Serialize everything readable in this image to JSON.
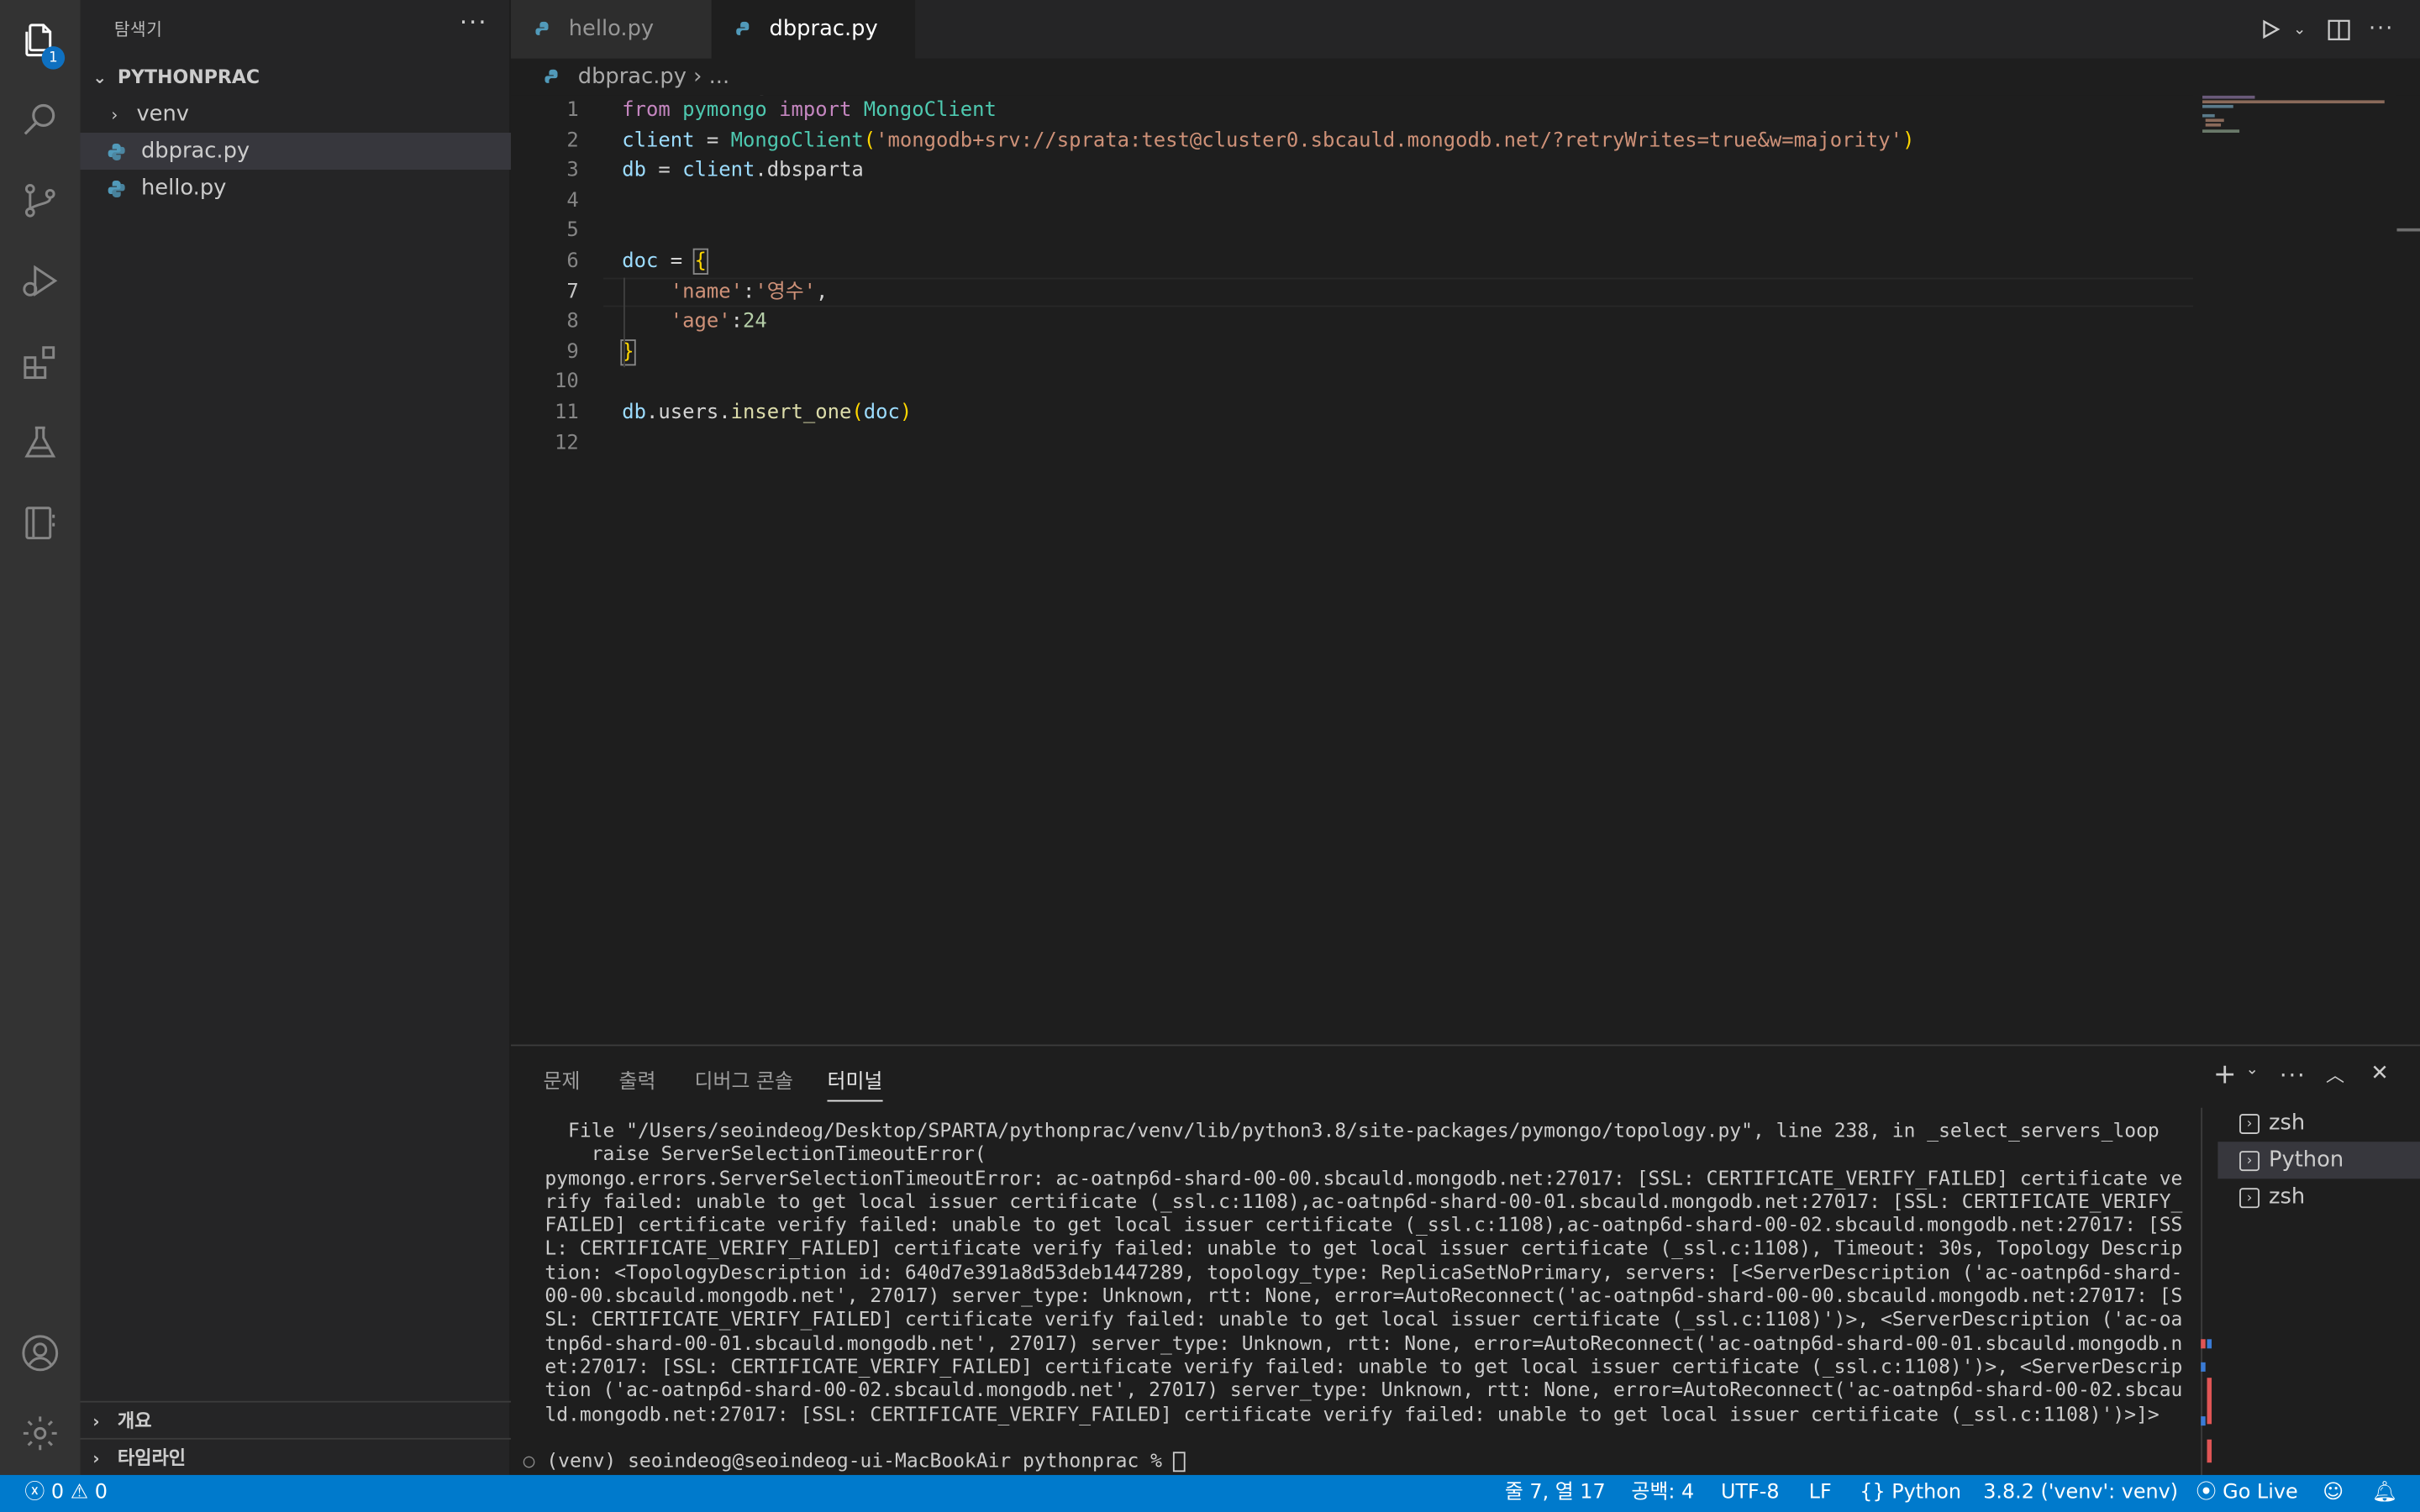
{
  "activity": {
    "explorer_badge": "1"
  },
  "sidebar": {
    "title": "탐색기",
    "more": "···",
    "project": "PYTHONPRAC",
    "items": [
      {
        "label": "venv",
        "type": "folder"
      },
      {
        "label": "dbprac.py",
        "type": "file"
      },
      {
        "label": "hello.py",
        "type": "file"
      }
    ],
    "outline": "개요",
    "timeline": "타임라인"
  },
  "tabs": [
    {
      "label": "hello.py",
      "active": false
    },
    {
      "label": "dbprac.py",
      "active": true,
      "modified": true
    }
  ],
  "breadcrumb": {
    "file": "dbprac.py",
    "rest": "..."
  },
  "editor": {
    "current_line": 7,
    "line_numbers": [
      "1",
      "2",
      "3",
      "4",
      "5",
      "6",
      "7",
      "8",
      "9",
      "10",
      "11",
      "12"
    ],
    "code": {
      "l1_from": "from",
      "l1_mod": "pymongo",
      "l1_import": "import",
      "l1_cls": "MongoClient",
      "l2_var": "client",
      "l2_eq": " = ",
      "l2_cls": "MongoClient",
      "l2_open": "(",
      "l2_str": "'mongodb+srv://sprata:test@cluster0.sbcauld.mongodb.net/?retryWrites=true&w=majority'",
      "l2_close": ")",
      "l3_var": "db",
      "l3_eq": " = ",
      "l3_obj": "client",
      "l3_attr": ".dbsparta",
      "l6_var": "doc",
      "l6_eq": " = ",
      "l6_brace": "{",
      "l7_k": "'name'",
      "l7_colon": ":",
      "l7_v": "'영수'",
      "l7_comma": ",",
      "l8_k": "'age'",
      "l8_colon": ":",
      "l8_v": "24",
      "l9_brace": "}",
      "l11_db": "db",
      "l11_users": ".users.",
      "l11_fn": "insert_one",
      "l11_open": "(",
      "l11_arg": "doc",
      "l11_close": ")"
    }
  },
  "panel": {
    "tabs": [
      "문제",
      "출력",
      "디버그 콘솔",
      "터미널"
    ],
    "active_tab": "터미널",
    "terminal_output": "  File \"/Users/seoindeog/Desktop/SPARTA/pythonprac/venv/lib/python3.8/site-packages/pymongo/topology.py\", line 238, in _select_servers_loop\n    raise ServerSelectionTimeoutError(\npymongo.errors.ServerSelectionTimeoutError: ac-oatnp6d-shard-00-00.sbcauld.mongodb.net:27017: [SSL: CERTIFICATE_VERIFY_FAILED] certificate verify failed: unable to get local issuer certificate (_ssl.c:1108),ac-oatnp6d-shard-00-01.sbcauld.mongodb.net:27017: [SSL: CERTIFICATE_VERIFY_FAILED] certificate verify failed: unable to get local issuer certificate (_ssl.c:1108),ac-oatnp6d-shard-00-02.sbcauld.mongodb.net:27017: [SSL: CERTIFICATE_VERIFY_FAILED] certificate verify failed: unable to get local issuer certificate (_ssl.c:1108), Timeout: 30s, Topology Description: <TopologyDescription id: 640d7e391a8d53deb1447289, topology_type: ReplicaSetNoPrimary, servers: [<ServerDescription ('ac-oatnp6d-shard-00-00.sbcauld.mongodb.net', 27017) server_type: Unknown, rtt: None, error=AutoReconnect('ac-oatnp6d-shard-00-00.sbcauld.mongodb.net:27017: [SSL: CERTIFICATE_VERIFY_FAILED] certificate verify failed: unable to get local issuer certificate (_ssl.c:1108)')>, <ServerDescription ('ac-oatnp6d-shard-00-01.sbcauld.mongodb.net', 27017) server_type: Unknown, rtt: None, error=AutoReconnect('ac-oatnp6d-shard-00-01.sbcauld.mongodb.net:27017: [SSL: CERTIFICATE_VERIFY_FAILED] certificate verify failed: unable to get local issuer certificate (_ssl.c:1108)')>, <ServerDescription ('ac-oatnp6d-shard-00-02.sbcauld.mongodb.net', 27017) server_type: Unknown, rtt: None, error=AutoReconnect('ac-oatnp6d-shard-00-02.sbcauld.mongodb.net:27017: [SSL: CERTIFICATE_VERIFY_FAILED] certificate verify failed: unable to get local issuer certificate (_ssl.c:1108)')>]>",
    "prompt": "(venv) seoindeog@seoindeog-ui-MacBookAir pythonprac % ",
    "terminals": [
      "zsh",
      "Python",
      "zsh"
    ]
  },
  "statusbar": {
    "errors": "0",
    "warnings": "0",
    "position": "줄 7, 열 17",
    "indent": "공백: 4",
    "encoding": "UTF-8",
    "eol": "LF",
    "language": "Python",
    "interpreter": "3.8.2 ('venv': venv)",
    "golive": "Go Live"
  },
  "colors": {
    "statusbar": "#007acc",
    "accent": "#0e70c0",
    "activity": "#333333",
    "sidebar": "#252526",
    "editor": "#1e1e1e"
  }
}
